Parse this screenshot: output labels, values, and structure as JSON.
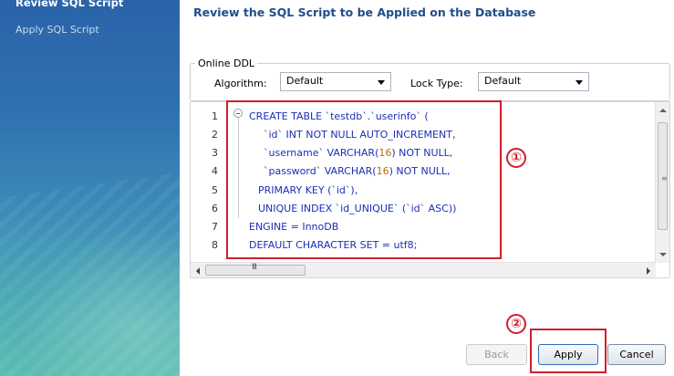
{
  "sidebar": {
    "steps": [
      "Review SQL Script",
      "Apply SQL Script"
    ]
  },
  "main": {
    "heading": "Review the SQL Script to be Applied on the Database"
  },
  "ddl": {
    "legend": "Online DDL",
    "algorithm_label": "Algorithm:",
    "algorithm_value": "Default",
    "lock_label": "Lock Type:",
    "lock_value": "Default"
  },
  "editor": {
    "line_numbers": [
      "1",
      "2",
      "3",
      "4",
      "5",
      "6",
      "7",
      "8"
    ],
    "lines": [
      "CREATE TABLE `testdb`.`userinfo` (",
      "`id` INT NOT NULL AUTO_INCREMENT,",
      "`username` VARCHAR(16) NOT NULL,",
      "`password` VARCHAR(16) NOT NULL,",
      "PRIMARY KEY (`id`),",
      "UNIQUE INDEX `id_UNIQUE` (`id` ASC))",
      "ENGINE = InnoDB",
      "DEFAULT CHARACTER SET = utf8;"
    ],
    "hscroll_grip": "III"
  },
  "annotations": {
    "marker1": "①",
    "marker2": "②",
    "accent_color": "#d01f2c"
  },
  "buttons": {
    "back": "Back",
    "apply": "Apply",
    "cancel": "Cancel"
  },
  "colors": {
    "heading": "#1f4e8c",
    "code": "#1b2fb5",
    "number_literal": "#c36a00"
  }
}
